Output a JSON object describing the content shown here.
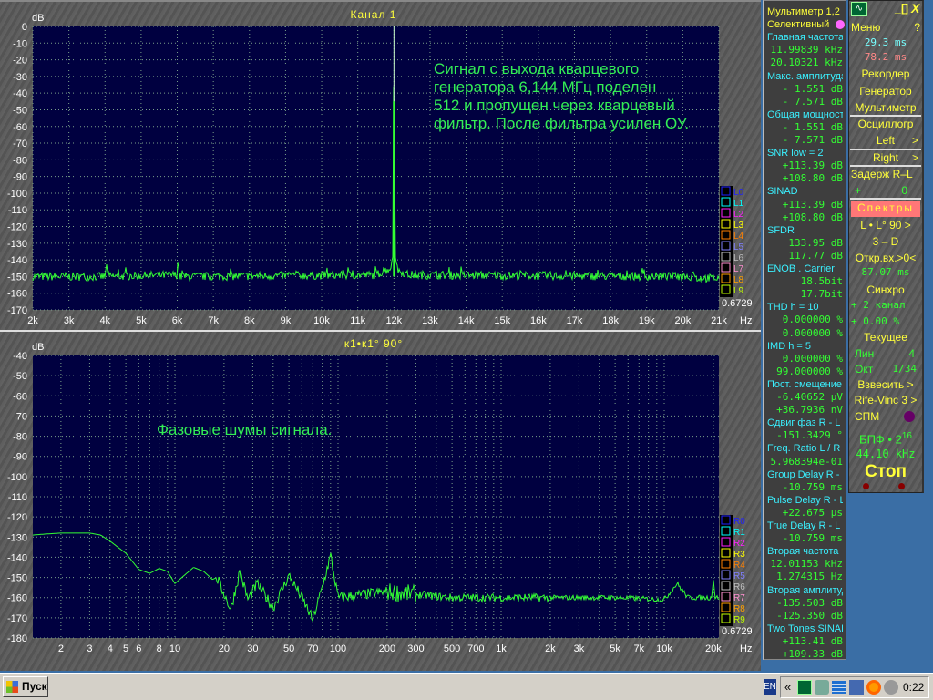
{
  "upper": {
    "title": "Канал 1",
    "unit_y": "dB",
    "unit_x": "Hz",
    "scale_value": "0.6729",
    "annotation": [
      "Сигнал с выхода кварцевого",
      "генератора 6,144 МГц поделен",
      "512 и пропущен через кварцевый",
      "фильтр. После фильтра усилен ОУ."
    ],
    "legend": [
      "L0",
      "L1",
      "L2",
      "L3",
      "L4",
      "L5",
      "L6",
      "L7",
      "L8",
      "L9"
    ]
  },
  "lower": {
    "title": "к1•к1° 90°",
    "unit_y": "dB",
    "unit_x": "Hz",
    "scale_value": "0.6729",
    "annotation": "Фазовые шумы сигнала.",
    "legend": [
      "R0",
      "R1",
      "R2",
      "R3",
      "R4",
      "R5",
      "R6",
      "R7",
      "R8",
      "R9"
    ]
  },
  "legend_colors": [
    "#2020ff",
    "#00ffff",
    "#ff20ff",
    "#ffff00",
    "#ff8000",
    "#8080ff",
    "#c0c0c0",
    "#ff90d0",
    "#ffa000",
    "#c0ff00"
  ],
  "trace_color": "#33ff33",
  "chart_data": [
    {
      "type": "line",
      "title": "Канал 1",
      "xscale": "linear",
      "xlim": [
        2000,
        21000
      ],
      "ylim": [
        -170,
        0
      ],
      "grid": true,
      "ylabel": "dB",
      "xlabel": "Hz",
      "yticks": [
        "0",
        "-10",
        "-20",
        "-30",
        "-40",
        "-50",
        "-60",
        "-70",
        "-80",
        "-90",
        "-100",
        "-110",
        "-120",
        "-130",
        "-140",
        "-150",
        "-160",
        "-170"
      ],
      "xticks": [
        "2k",
        "3k",
        "4k",
        "5k",
        "6k",
        "7k",
        "8k",
        "9k",
        "10k",
        "11k",
        "12k",
        "13k",
        "14k",
        "15k",
        "16k",
        "17k",
        "18k",
        "19k",
        "20k",
        "21k"
      ],
      "noise_floor_db": -150,
      "points": [
        [
          2000,
          -150
        ],
        [
          4000,
          -150
        ],
        [
          4050,
          -143
        ],
        [
          4100,
          -150
        ],
        [
          6000,
          -149
        ],
        [
          6020,
          -141
        ],
        [
          6060,
          -150
        ],
        [
          11500,
          -149
        ],
        [
          11900,
          -145
        ],
        [
          11970,
          -138
        ],
        [
          11990,
          -45
        ],
        [
          12000,
          0
        ],
        [
          12010,
          -45
        ],
        [
          12030,
          -137
        ],
        [
          12100,
          -146
        ],
        [
          12400,
          -149
        ],
        [
          20250,
          -150
        ],
        [
          20300,
          -145
        ],
        [
          20350,
          -151
        ],
        [
          21000,
          -151
        ]
      ]
    },
    {
      "type": "line",
      "title": "к1•к1° 90°",
      "xscale": "log",
      "xlim": [
        1.34,
        21600
      ],
      "ylim": [
        -180,
        -40
      ],
      "grid": true,
      "ylabel": "dB",
      "xlabel": "Hz",
      "yticks": [
        "-40",
        "-50",
        "-60",
        "-70",
        "-80",
        "-90",
        "-100",
        "-110",
        "-120",
        "-130",
        "-140",
        "-150",
        "-160",
        "-170",
        "-180"
      ],
      "xticks": [
        "2",
        "3",
        "4",
        "5",
        "6",
        "8",
        "10",
        "20",
        "30",
        "50",
        "70",
        "100",
        "200",
        "300",
        "500",
        "700",
        "1k",
        "2k",
        "3k",
        "5k",
        "7k",
        "10k",
        "20k"
      ],
      "points": [
        [
          1.34,
          -129
        ],
        [
          1.6,
          -128.5
        ],
        [
          2,
          -128
        ],
        [
          3,
          -128
        ],
        [
          3.5,
          -129
        ],
        [
          4,
          -132
        ],
        [
          5,
          -138
        ],
        [
          6,
          -146
        ],
        [
          7,
          -148
        ],
        [
          8,
          -145.5
        ],
        [
          9,
          -147
        ],
        [
          10,
          -153
        ],
        [
          13,
          -145
        ],
        [
          15,
          -147
        ],
        [
          17,
          -151
        ],
        [
          18,
          -150
        ],
        [
          20,
          -158
        ],
        [
          22,
          -166
        ],
        [
          25,
          -147
        ],
        [
          28,
          -161
        ],
        [
          32,
          -153
        ],
        [
          40,
          -165
        ],
        [
          50,
          -149
        ],
        [
          60,
          -160
        ],
        [
          70,
          -171
        ],
        [
          80,
          -155
        ],
        [
          90,
          -139
        ],
        [
          100,
          -160
        ],
        [
          200,
          -157
        ],
        [
          500,
          -160
        ],
        [
          1000,
          -160
        ],
        [
          5000,
          -160
        ],
        [
          10000,
          -161
        ],
        [
          12000,
          -153
        ],
        [
          14000,
          -160
        ],
        [
          19500,
          -160
        ],
        [
          20000,
          -150
        ],
        [
          20500,
          -160
        ],
        [
          21600,
          -160
        ]
      ]
    }
  ],
  "multimeter": {
    "rows": [
      [
        "y",
        "Мультиметр 1,2"
      ],
      [
        "y",
        "Селективный"
      ],
      [
        "c",
        "Главная частота"
      ],
      [
        "g",
        "11.99839 kHz"
      ],
      [
        "g",
        "20.10321 kHz"
      ],
      [
        "c",
        "Макс. амплитуда"
      ],
      [
        "g",
        "-   1.551 dB"
      ],
      [
        "g",
        "-   7.571 dB"
      ],
      [
        "c",
        "Общая мощность"
      ],
      [
        "g",
        "-   1.551 dB"
      ],
      [
        "g",
        "-   7.571 dB"
      ],
      [
        "c",
        "SNR      low =  2"
      ],
      [
        "g",
        "+113.39 dB"
      ],
      [
        "g",
        "+108.80 dB"
      ],
      [
        "c",
        "SINAD"
      ],
      [
        "g",
        "+113.39 dB"
      ],
      [
        "g",
        "+108.80 dB"
      ],
      [
        "c",
        "SFDR"
      ],
      [
        "g",
        "133.95 dB"
      ],
      [
        "g",
        "117.77 dB"
      ],
      [
        "c",
        "ENOB . Carrier"
      ],
      [
        "g",
        "18.5bit"
      ],
      [
        "g",
        "17.7bit"
      ],
      [
        "c",
        "THD        h = 10"
      ],
      [
        "g",
        "0.000000 %"
      ],
      [
        "g",
        "0.000000 %"
      ],
      [
        "c",
        "IMD        h =  5"
      ],
      [
        "g",
        "0.000000 %"
      ],
      [
        "g",
        "99.000000 %"
      ],
      [
        "c",
        "Пост. смещение"
      ],
      [
        "g",
        "-6.40652 µV"
      ],
      [
        "g",
        "+36.7936 nV"
      ],
      [
        "c",
        "Сдвиг фаз R - L"
      ],
      [
        "g",
        "-151.3429 °"
      ],
      [
        "c",
        "Freq. Ratio  L / R"
      ],
      [
        "g",
        "5.968394e-01"
      ],
      [
        "c",
        "Group Delay R - L"
      ],
      [
        "g",
        "-10.759 ms"
      ],
      [
        "c",
        "Pulse Delay R - L"
      ],
      [
        "g",
        "+22.675 µs"
      ],
      [
        "c",
        "True Delay R - L"
      ],
      [
        "g",
        "-10.759 ms"
      ],
      [
        "c",
        "Вторая частота"
      ],
      [
        "g",
        "12.01153 kHz"
      ],
      [
        "g",
        "1.274315  Hz"
      ],
      [
        "c",
        "Вторая амплитуда"
      ],
      [
        "g",
        "-135.503 dB"
      ],
      [
        "g",
        "-125.350 dB"
      ],
      [
        "c",
        "Two Tones SINAD"
      ],
      [
        "g",
        "+113.41 dB"
      ],
      [
        "g",
        "+109.33 dB"
      ]
    ]
  },
  "controls": {
    "minimize": "_",
    "maximize": "[]",
    "close": "X",
    "menu": "Меню",
    "help": "?",
    "time1": "29.3 ms",
    "time2": "78.2 ms",
    "recorder": "Рекордер",
    "generator": "Генератор",
    "multimeter": "Мультиметр",
    "oscillo": "Осциллогр",
    "left": "Left",
    "right": "Right",
    "arrow": ">",
    "delay": "Задерж  R–L",
    "delay_sign": "+",
    "delay_val": "0",
    "spectra": "Спектры",
    "mode": "L • L° 90",
    "view3d": "3 – D",
    "open_input": "Откр.вх.>0<",
    "time3": "87.07 ms",
    "sync": "Синхро",
    "sync_ch": "+  2 канал",
    "sync_pct": "+  0.00 %",
    "current": "Текущее",
    "lin": "Лин",
    "lin_val": "4",
    "oct": "Окт",
    "oct_val": "1/34",
    "weight": "Взвесить",
    "window": "Rife-Vinc 3",
    "psd": "СПМ",
    "fft": "БПФ • 2",
    "fft_exp": "16",
    "rate": "44.10 kHz",
    "stop": "Стоп"
  },
  "taskbar": {
    "start": "Пуск",
    "lang": "EN",
    "clock": "0:22",
    "expand": "«"
  }
}
